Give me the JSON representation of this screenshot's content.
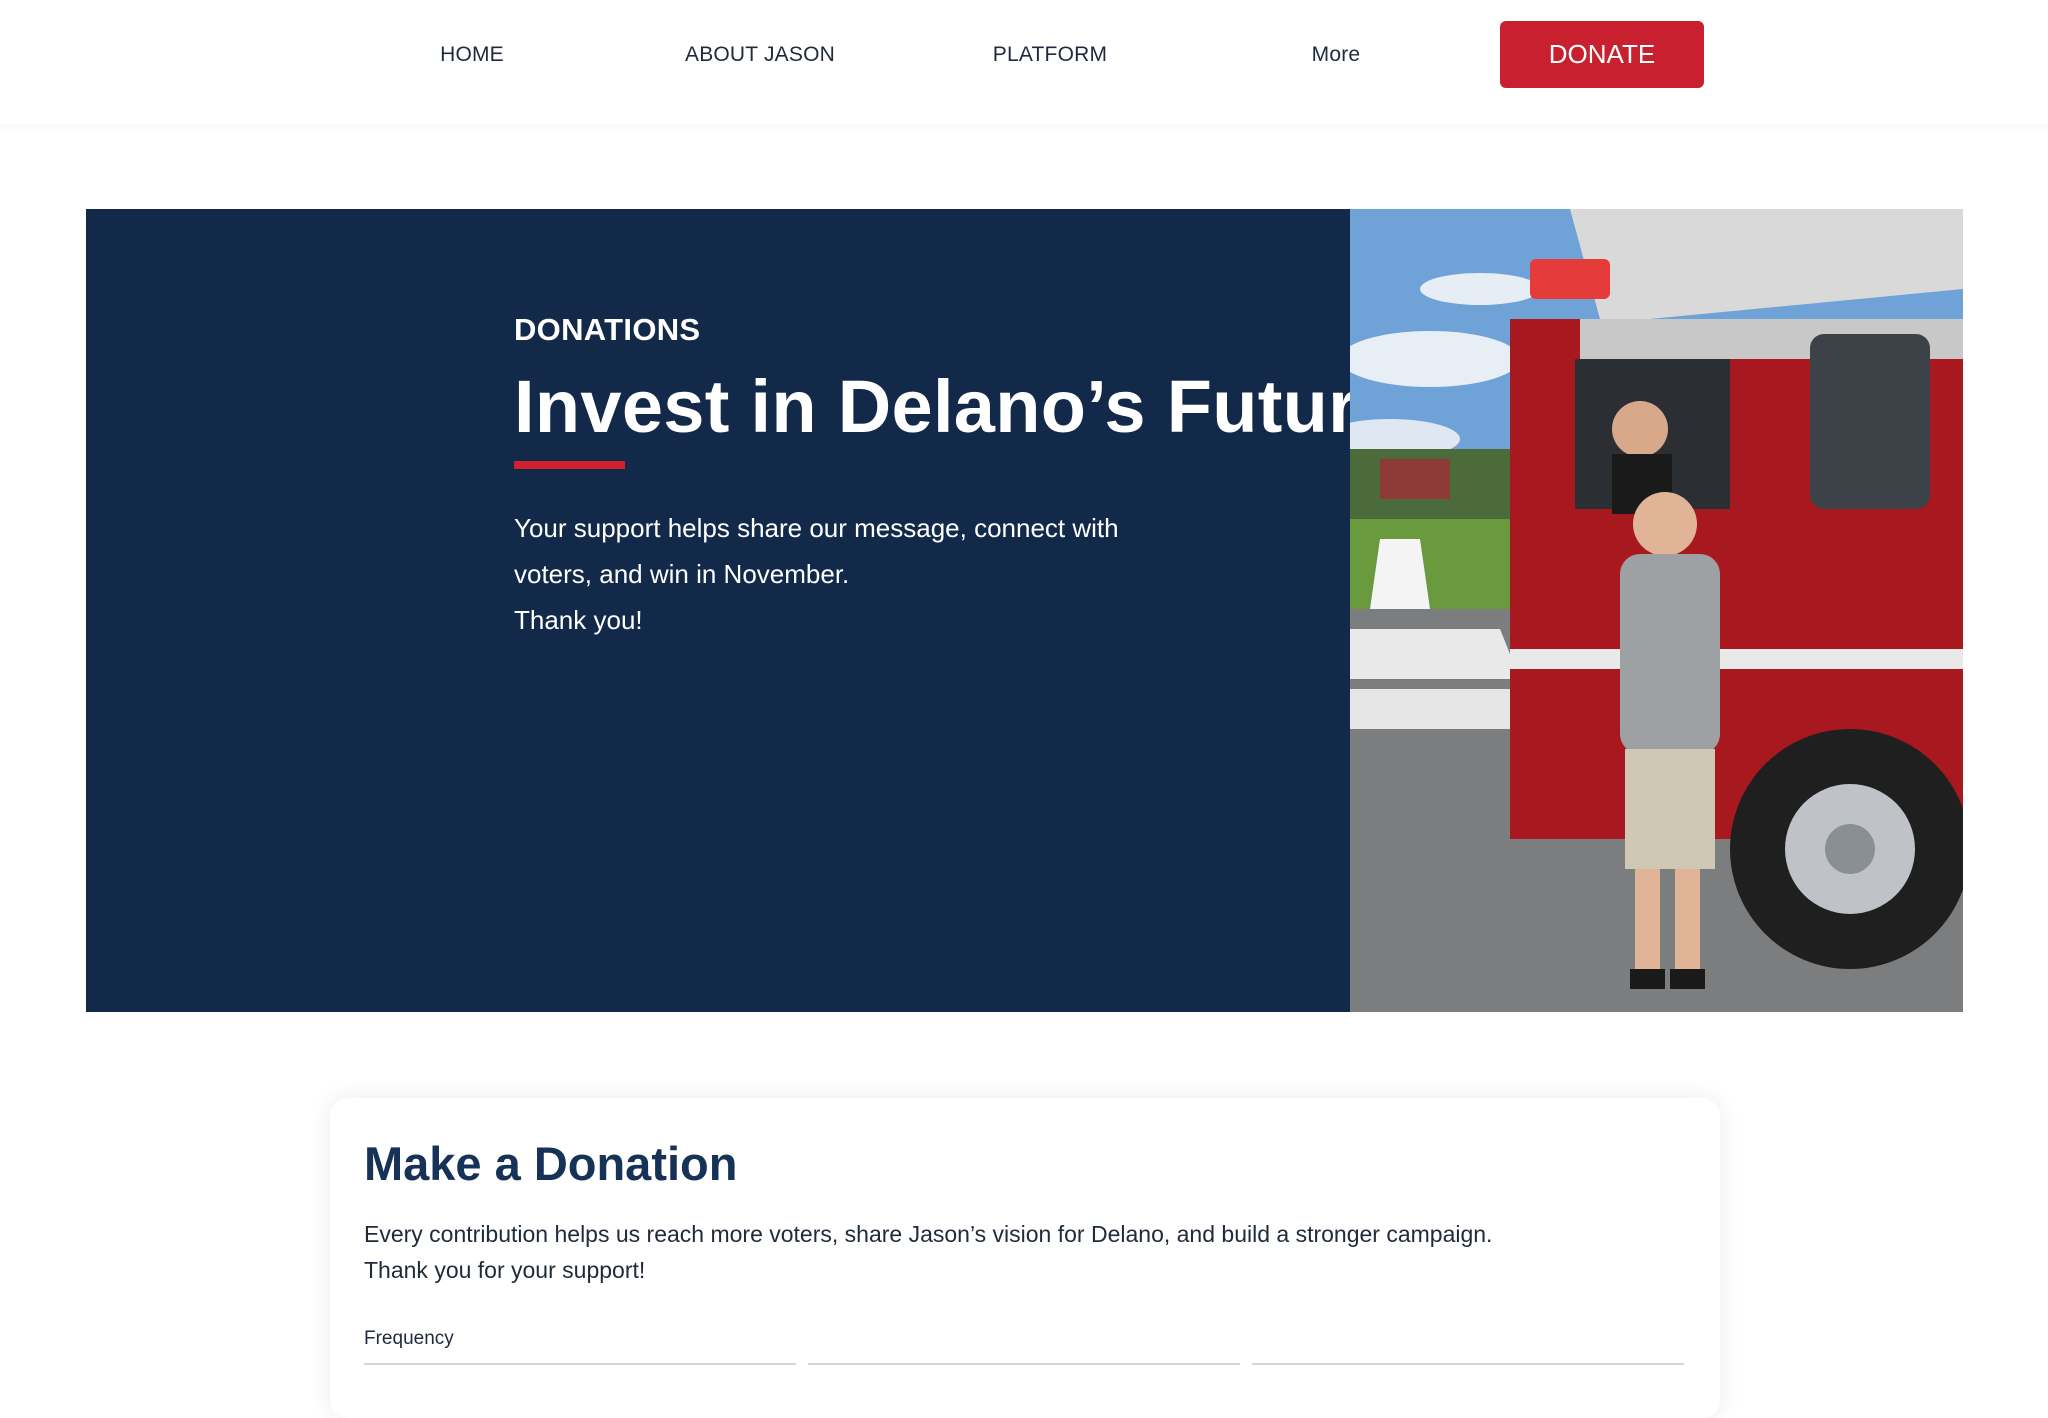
{
  "nav": {
    "home": "HOME",
    "about": "ABOUT JASON",
    "platform": "PLATFORM",
    "more": "More",
    "donate": "DONATE"
  },
  "hero": {
    "eyebrow": "DONATIONS",
    "title": "Invest in Delano’s Future",
    "body_line1": "Your support helps share our message, connect with",
    "body_line2": "voters, and win in November.",
    "body_line3": "Thank you!"
  },
  "card": {
    "title": "Make a Donation",
    "body_line1": "Every contribution helps us reach more voters, share Jason’s vision for Delano, and build a stronger campaign.",
    "body_line2": "Thank you for your support!",
    "frequency_label": "Frequency"
  },
  "colors": {
    "navy": "#13294a",
    "accent_red": "#c8202e",
    "title_blue": "#163257"
  }
}
